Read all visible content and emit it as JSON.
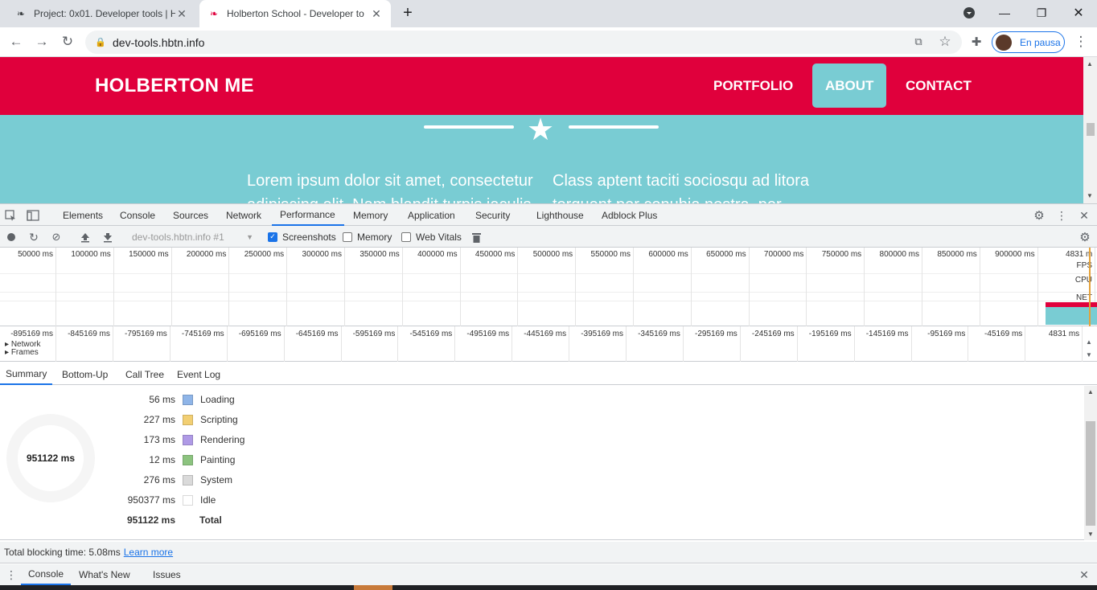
{
  "browser": {
    "tabs": [
      {
        "title": "Project: 0x01. Developer tools | H",
        "active": false
      },
      {
        "title": "Holberton School - Developer to",
        "active": true
      }
    ],
    "new_tab": "+",
    "url": "dev-tools.hbtn.info",
    "profile_label": "En pausa"
  },
  "page": {
    "brand": "HOLBERTON ME",
    "nav": [
      "PORTFOLIO",
      "ABOUT",
      "CONTACT"
    ],
    "active_nav": "ABOUT",
    "lorem_left": "Lorem ipsum dolor sit amet, consectetur adipiscing elit. Nam blandit turpis iaculis",
    "lorem_right": "Class aptent taciti sociosqu ad litora torquent per conubia nostra, per",
    "colors": {
      "brand_red": "#e0003c",
      "teal": "#79ccd3"
    }
  },
  "devtools": {
    "tabs": [
      "Elements",
      "Console",
      "Sources",
      "Network",
      "Performance",
      "Memory",
      "Application",
      "Security",
      "Lighthouse",
      "Adblock Plus"
    ],
    "active_tab": "Performance",
    "target": "dev-tools.hbtn.info #1",
    "checkboxes": [
      {
        "label": "Screenshots",
        "checked": true
      },
      {
        "label": "Memory",
        "checked": false
      },
      {
        "label": "Web Vitals",
        "checked": false
      }
    ],
    "overview_ticks": [
      "50000 ms",
      "100000 ms",
      "150000 ms",
      "200000 ms",
      "250000 ms",
      "300000 ms",
      "350000 ms",
      "400000 ms",
      "450000 ms",
      "500000 ms",
      "550000 ms",
      "600000 ms",
      "650000 ms",
      "700000 ms",
      "750000 ms",
      "800000 ms",
      "850000 ms",
      "900000 ms",
      "4831 m"
    ],
    "lanes": [
      "FPS",
      "CPU",
      "NET"
    ],
    "ruler_ticks": [
      "-895169 ms",
      "-845169 ms",
      "-795169 ms",
      "-745169 ms",
      "-695169 ms",
      "-645169 ms",
      "-595169 ms",
      "-545169 ms",
      "-495169 ms",
      "-445169 ms",
      "-395169 ms",
      "-345169 ms",
      "-295169 ms",
      "-245169 ms",
      "-195169 ms",
      "-145169 ms",
      "-95169 ms",
      "-45169 ms",
      "4831 ms"
    ],
    "tracks": [
      "Network",
      "Frames"
    ],
    "summary_tabs": [
      "Summary",
      "Bottom-Up",
      "Call Tree",
      "Event Log"
    ],
    "summary": {
      "total_center": "951122 ms",
      "rows": [
        {
          "value": "56 ms",
          "label": "Loading",
          "color": "#8fb5e8"
        },
        {
          "value": "227 ms",
          "label": "Scripting",
          "color": "#f2cf73"
        },
        {
          "value": "173 ms",
          "label": "Rendering",
          "color": "#af9ae6"
        },
        {
          "value": "12 ms",
          "label": "Painting",
          "color": "#8cc37f"
        },
        {
          "value": "276 ms",
          "label": "System",
          "color": "#dadada"
        },
        {
          "value": "950377 ms",
          "label": "Idle",
          "color": "#ffffff"
        }
      ],
      "total_value": "951122 ms",
      "total_label": "Total"
    },
    "footer_text": "Total blocking time: 5.08ms",
    "footer_link": "Learn more",
    "drawer_tabs": [
      "Console",
      "What's New",
      "Issues"
    ]
  }
}
